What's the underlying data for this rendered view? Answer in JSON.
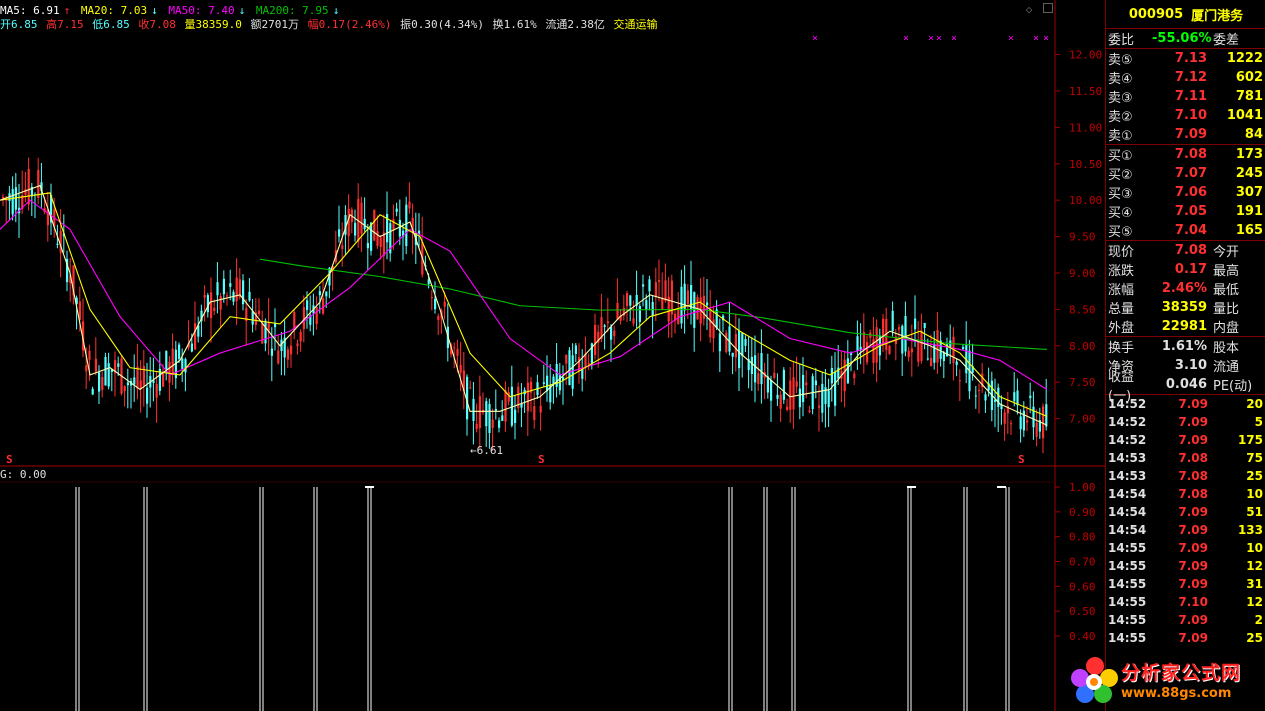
{
  "indicators": {
    "ma5": "MA5: 6.91",
    "ma20": "MA20: 7.03",
    "ma50": "MA50: 7.40",
    "ma200": "MA200: 7.95"
  },
  "quote_line": {
    "open": "开6.85",
    "high": "高7.15",
    "low": "低6.85",
    "close": "收7.08",
    "volume": "量38359.0",
    "amount": "额2701万",
    "change": "幅0.17(2.46%)",
    "amplitude": "振0.30(4.34%)",
    "turnover": "换1.61%",
    "float": "流通2.38亿",
    "sector": "交通运输"
  },
  "sub_indicator": {
    "label": "G: 0.00"
  },
  "chart_labels": {
    "low_marker": "←6.61",
    "s_marker": "S"
  },
  "price_axis": [
    "12.00",
    "11.50",
    "11.00",
    "10.50",
    "10.00",
    "9.50",
    "9.00",
    "8.50",
    "8.00",
    "7.50",
    "7.00"
  ],
  "sub_axis": [
    "1.00",
    "0.90",
    "0.80",
    "0.70",
    "0.60",
    "0.50",
    "0.40"
  ],
  "chart_data": {
    "type": "candlestick",
    "price_range": [
      6.5,
      12.2
    ],
    "series": [
      {
        "name": "MA5"
      },
      {
        "name": "MA20"
      },
      {
        "name": "MA50"
      },
      {
        "name": "MA200"
      }
    ],
    "ma200": [
      [
        260,
        9.19
      ],
      [
        300,
        9.1
      ],
      [
        380,
        8.95
      ],
      [
        450,
        8.78
      ],
      [
        520,
        8.55
      ],
      [
        600,
        8.49
      ],
      [
        700,
        8.5
      ],
      [
        760,
        8.39
      ],
      [
        850,
        8.18
      ],
      [
        950,
        8.03
      ],
      [
        1047,
        7.95
      ]
    ],
    "ma50": [
      [
        0,
        9.6
      ],
      [
        30,
        10.0
      ],
      [
        70,
        9.6
      ],
      [
        120,
        8.4
      ],
      [
        170,
        7.6
      ],
      [
        220,
        7.9
      ],
      [
        290,
        8.2
      ],
      [
        350,
        8.8
      ],
      [
        410,
        9.6
      ],
      [
        450,
        9.3
      ],
      [
        510,
        8.1
      ],
      [
        560,
        7.6
      ],
      [
        620,
        7.85
      ],
      [
        680,
        8.4
      ],
      [
        730,
        8.6
      ],
      [
        790,
        8.1
      ],
      [
        850,
        7.9
      ],
      [
        900,
        8.1
      ],
      [
        960,
        7.95
      ],
      [
        1000,
        7.8
      ],
      [
        1047,
        7.4
      ]
    ],
    "ma20": [
      [
        0,
        10.0
      ],
      [
        50,
        10.1
      ],
      [
        90,
        8.5
      ],
      [
        130,
        7.7
      ],
      [
        180,
        7.6
      ],
      [
        230,
        8.4
      ],
      [
        280,
        8.3
      ],
      [
        330,
        9.0
      ],
      [
        380,
        9.8
      ],
      [
        420,
        9.5
      ],
      [
        470,
        7.9
      ],
      [
        510,
        7.3
      ],
      [
        560,
        7.5
      ],
      [
        610,
        7.9
      ],
      [
        650,
        8.4
      ],
      [
        700,
        8.6
      ],
      [
        740,
        8.2
      ],
      [
        790,
        7.8
      ],
      [
        830,
        7.6
      ],
      [
        880,
        8.0
      ],
      [
        920,
        8.2
      ],
      [
        960,
        7.9
      ],
      [
        1000,
        7.3
      ],
      [
        1047,
        7.03
      ]
    ],
    "ma5": [
      [
        0,
        10.0
      ],
      [
        40,
        10.2
      ],
      [
        70,
        9.0
      ],
      [
        90,
        7.6
      ],
      [
        110,
        7.7
      ],
      [
        140,
        7.4
      ],
      [
        180,
        7.8
      ],
      [
        210,
        8.6
      ],
      [
        240,
        8.7
      ],
      [
        280,
        8.0
      ],
      [
        320,
        8.6
      ],
      [
        350,
        9.8
      ],
      [
        380,
        9.5
      ],
      [
        410,
        9.7
      ],
      [
        440,
        8.5
      ],
      [
        470,
        7.1
      ],
      [
        500,
        7.1
      ],
      [
        540,
        7.3
      ],
      [
        580,
        7.8
      ],
      [
        620,
        8.4
      ],
      [
        650,
        8.7
      ],
      [
        700,
        8.5
      ],
      [
        740,
        7.9
      ],
      [
        790,
        7.3
      ],
      [
        830,
        7.4
      ],
      [
        860,
        7.9
      ],
      [
        890,
        8.2
      ],
      [
        930,
        8.0
      ],
      [
        960,
        7.8
      ],
      [
        1000,
        7.2
      ],
      [
        1047,
        6.91
      ]
    ],
    "signals": [
      76,
      144,
      260,
      314,
      368,
      729,
      764,
      792,
      908,
      964,
      1006
    ],
    "signal_ticks": [
      910,
      1000
    ],
    "buy_marks_x": [
      815,
      906,
      931,
      939,
      954,
      1011,
      1036,
      1046
    ]
  },
  "panel": {
    "code": "000905",
    "name": "厦门港务",
    "weibi_label": "委比",
    "weibi_value": "-55.06%",
    "weicha_label": "委差",
    "asks": [
      {
        "label": "卖⑤",
        "price": "7.13",
        "vol": "1222"
      },
      {
        "label": "卖④",
        "price": "7.12",
        "vol": "602"
      },
      {
        "label": "卖③",
        "price": "7.11",
        "vol": "781"
      },
      {
        "label": "卖②",
        "price": "7.10",
        "vol": "1041"
      },
      {
        "label": "卖①",
        "price": "7.09",
        "vol": "84"
      }
    ],
    "bids": [
      {
        "label": "买①",
        "price": "7.08",
        "vol": "173"
      },
      {
        "label": "买②",
        "price": "7.07",
        "vol": "245"
      },
      {
        "label": "买③",
        "price": "7.06",
        "vol": "307"
      },
      {
        "label": "买④",
        "price": "7.05",
        "vol": "191"
      },
      {
        "label": "买⑤",
        "price": "7.04",
        "vol": "165"
      }
    ],
    "stats": [
      {
        "label": "现价",
        "value": "7.08",
        "label2": "今开"
      },
      {
        "label": "涨跌",
        "value": "0.17",
        "label2": "最高"
      },
      {
        "label": "涨幅",
        "value": "2.46%",
        "label2": "最低"
      },
      {
        "label": "总量",
        "value": "38359",
        "label2": "量比"
      },
      {
        "label": "外盘",
        "value": "22981",
        "label2": "内盘"
      }
    ],
    "stats2": [
      {
        "label": "换手",
        "value": "1.61%",
        "label2": "股本"
      },
      {
        "label": "净资",
        "value": "3.10",
        "label2": "流通"
      },
      {
        "label": "收益(一)",
        "value": "0.046",
        "label2": "PE(动)"
      }
    ],
    "ticks": [
      {
        "time": "14:52",
        "price": "7.09",
        "vol": "20"
      },
      {
        "time": "14:52",
        "price": "7.09",
        "vol": "5"
      },
      {
        "time": "14:52",
        "price": "7.09",
        "vol": "175"
      },
      {
        "time": "14:53",
        "price": "7.08",
        "vol": "75"
      },
      {
        "time": "14:53",
        "price": "7.08",
        "vol": "25"
      },
      {
        "time": "14:54",
        "price": "7.08",
        "vol": "10"
      },
      {
        "time": "14:54",
        "price": "7.09",
        "vol": "51"
      },
      {
        "time": "14:54",
        "price": "7.09",
        "vol": "133"
      },
      {
        "time": "14:55",
        "price": "7.09",
        "vol": "10"
      },
      {
        "time": "14:55",
        "price": "7.09",
        "vol": "12"
      },
      {
        "time": "14:55",
        "price": "7.09",
        "vol": "31"
      },
      {
        "time": "14:55",
        "price": "7.10",
        "vol": "12"
      },
      {
        "time": "14:55",
        "price": "7.09",
        "vol": "2"
      },
      {
        "time": "14:55",
        "price": "7.09",
        "vol": "25"
      }
    ]
  },
  "watermark": {
    "text": "分析家公式网",
    "url": "www.88gs.com"
  },
  "colors": {
    "up": "#ff3030",
    "down": "#54ffff",
    "ma5": "#ffffaa",
    "ma20": "#ffff00",
    "ma50": "#ff00ff",
    "ma200": "#00c000",
    "axis": "#a00000"
  }
}
